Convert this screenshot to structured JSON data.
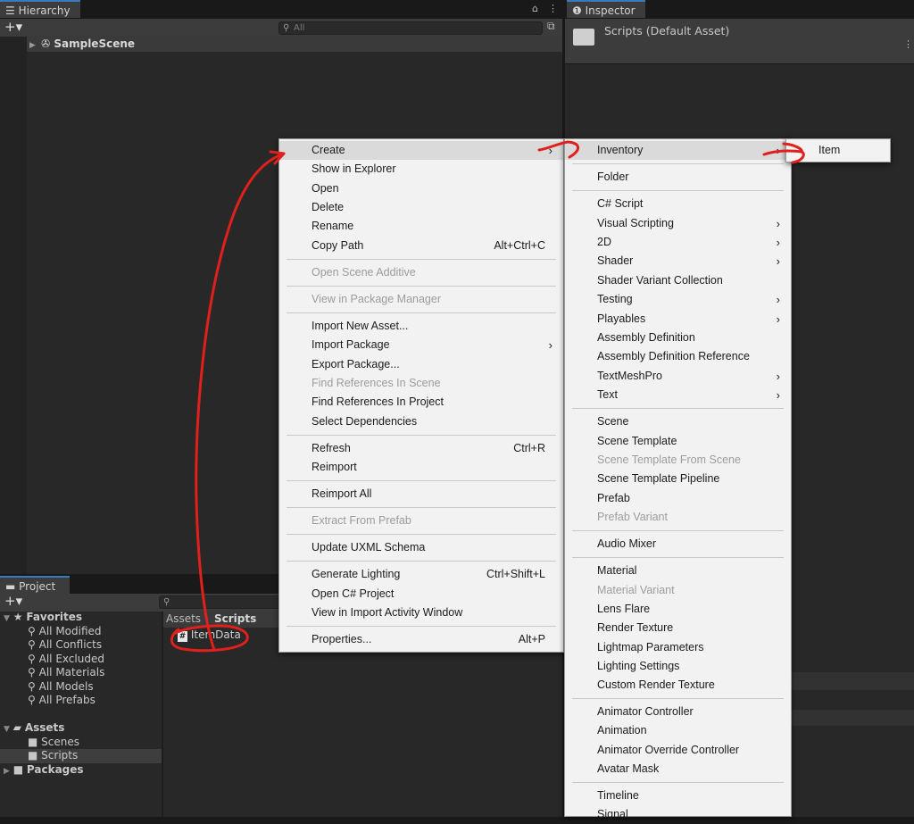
{
  "hierarchy": {
    "tab": "Hierarchy",
    "search_placeholder": "All",
    "scene": "SampleScene"
  },
  "inspector": {
    "tab": "Inspector",
    "title": "Scripts (Default Asset)"
  },
  "project": {
    "tab": "Project",
    "favorites_label": "Favorites",
    "favorites": [
      "All Modified",
      "All Conflicts",
      "All Excluded",
      "All Materials",
      "All Models",
      "All Prefabs"
    ],
    "assets_label": "Assets",
    "assets_children": [
      "Scenes",
      "Scripts"
    ],
    "packages_label": "Packages",
    "breadcrumb": [
      "Assets",
      "Scripts"
    ],
    "file": "ItemData"
  },
  "context_menu": {
    "create": "Create",
    "show_in_explorer": "Show in Explorer",
    "open": "Open",
    "delete": "Delete",
    "rename": "Rename",
    "copy_path": "Copy Path",
    "copy_path_sc": "Alt+Ctrl+C",
    "open_scene_additive": "Open Scene Additive",
    "view_in_package_manager": "View in Package Manager",
    "import_new_asset": "Import New Asset...",
    "import_package": "Import Package",
    "export_package": "Export Package...",
    "find_refs_scene": "Find References In Scene",
    "find_refs_project": "Find References In Project",
    "select_dependencies": "Select Dependencies",
    "refresh": "Refresh",
    "refresh_sc": "Ctrl+R",
    "reimport": "Reimport",
    "reimport_all": "Reimport All",
    "extract_from_prefab": "Extract From Prefab",
    "update_uxml": "Update UXML Schema",
    "generate_lighting": "Generate Lighting",
    "generate_lighting_sc": "Ctrl+Shift+L",
    "open_csharp": "Open C# Project",
    "view_import_activity": "View in Import Activity Window",
    "properties": "Properties...",
    "properties_sc": "Alt+P"
  },
  "create_menu": {
    "inventory": "Inventory",
    "folder": "Folder",
    "csharp_script": "C# Script",
    "visual_scripting": "Visual Scripting",
    "two_d": "2D",
    "shader": "Shader",
    "shader_variant_collection": "Shader Variant Collection",
    "testing": "Testing",
    "playables": "Playables",
    "assembly_definition": "Assembly Definition",
    "assembly_definition_reference": "Assembly Definition Reference",
    "textmeshpro": "TextMeshPro",
    "text": "Text",
    "scene": "Scene",
    "scene_template": "Scene Template",
    "scene_template_from_scene": "Scene Template From Scene",
    "scene_template_pipeline": "Scene Template Pipeline",
    "prefab": "Prefab",
    "prefab_variant": "Prefab Variant",
    "audio_mixer": "Audio Mixer",
    "material": "Material",
    "material_variant": "Material Variant",
    "lens_flare": "Lens Flare",
    "render_texture": "Render Texture",
    "lightmap_parameters": "Lightmap Parameters",
    "lighting_settings": "Lighting Settings",
    "custom_render_texture": "Custom Render Texture",
    "animator_controller": "Animator Controller",
    "animation": "Animation",
    "animator_override_controller": "Animator Override Controller",
    "avatar_mask": "Avatar Mask",
    "timeline": "Timeline",
    "signal": "Signal"
  },
  "inventory_menu": {
    "item": "Item"
  },
  "colors": {
    "annotation": "#e0201c",
    "panel": "#282828",
    "menu": "#f2f2f2"
  }
}
